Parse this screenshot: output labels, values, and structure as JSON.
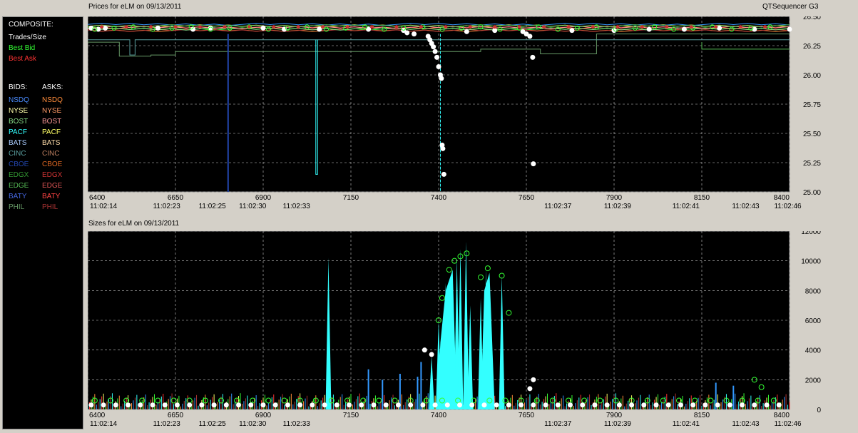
{
  "app_title": "QTSequencer G3",
  "legend": {
    "composite_label": "COMPOSITE:",
    "trades_label": "Trades/Size",
    "best_bid_label": "Best Bid",
    "best_ask_label": "Best Ask",
    "bids_header": "BIDS:",
    "asks_header": "ASKS:",
    "colors": {
      "trades": "#ffffff",
      "best_bid": "#33ff33",
      "best_ask": "#ff3333"
    },
    "exchanges": [
      {
        "bid": "NSDQ",
        "ask": "NSDQ",
        "bid_color": "#4a8cff",
        "ask_color": "#ff8c3a"
      },
      {
        "bid": "NYSE",
        "ask": "NYSE",
        "bid_color": "#ffffaa",
        "ask_color": "#ff9966"
      },
      {
        "bid": "BOST",
        "ask": "BOST",
        "bid_color": "#88dd88",
        "ask_color": "#ff9999"
      },
      {
        "bid": "PACF",
        "ask": "PACF",
        "bid_color": "#33ffff",
        "ask_color": "#ffff66"
      },
      {
        "bid": "BATS",
        "ask": "BATS",
        "bid_color": "#aaccff",
        "ask_color": "#ffddaa"
      },
      {
        "bid": "CINC",
        "ask": "CINC",
        "bid_color": "#5aa0a0",
        "ask_color": "#c08060"
      },
      {
        "bid": "CBOE",
        "ask": "CBOE",
        "bid_color": "#2244aa",
        "ask_color": "#dd6622"
      },
      {
        "bid": "EDGX",
        "ask": "EDGX",
        "bid_color": "#339933",
        "ask_color": "#cc3333"
      },
      {
        "bid": "EDGE",
        "ask": "EDGE",
        "bid_color": "#55bb55",
        "ask_color": "#dd5555"
      },
      {
        "bid": "BATY",
        "ask": "BATY",
        "bid_color": "#4466dd",
        "ask_color": "#ff4444"
      },
      {
        "bid": "PHIL",
        "ask": "PHIL",
        "bid_color": "#669966",
        "ask_color": "#aa3333"
      }
    ]
  },
  "chart_data": [
    {
      "type": "line",
      "title": "Prices for  eLM  on  09/13/2011",
      "ylim": [
        25.0,
        26.5
      ],
      "xlim": [
        6400,
        8400
      ],
      "y_ticks": [
        "25.00",
        "25.25",
        "25.50",
        "25.75",
        "26.00",
        "26.25",
        "26.50"
      ],
      "x_ticks": [
        "6400",
        "6650",
        "6900",
        "7150",
        "7400",
        "7650",
        "7900",
        "8150",
        "8400"
      ],
      "time_labels": [
        "11:02:14",
        "11:02:23",
        "11:02:25",
        "11:02:30",
        "11:02:33",
        "11:02:37",
        "11:02:39",
        "11:02:41",
        "11:02:43",
        "11:02:46"
      ],
      "grid": true,
      "series": [
        {
          "name": "Best Bid",
          "color": "#33ff33",
          "values": [
            [
              6400,
              26.41
            ],
            [
              7400,
              26.4
            ],
            [
              8400,
              26.4
            ]
          ]
        },
        {
          "name": "Best Ask",
          "color": "#ff3333",
          "values": [
            [
              6400,
              26.43
            ],
            [
              7400,
              26.42
            ],
            [
              8400,
              26.42
            ]
          ]
        },
        {
          "name": "Trades/Size",
          "color": "#ffffff",
          "type": "scatter",
          "points": [
            [
              6410,
              26.4
            ],
            [
              6430,
              26.39
            ],
            [
              6450,
              26.4
            ],
            [
              6600,
              26.4
            ],
            [
              6700,
              26.39
            ],
            [
              6750,
              26.4
            ],
            [
              6900,
              26.4
            ],
            [
              6960,
              26.39
            ],
            [
              7060,
              26.39
            ],
            [
              7200,
              26.39
            ],
            [
              7300,
              26.38
            ],
            [
              7310,
              26.36
            ],
            [
              7330,
              26.35
            ],
            [
              7370,
              26.33
            ],
            [
              7375,
              26.3
            ],
            [
              7380,
              26.27
            ],
            [
              7385,
              26.24
            ],
            [
              7390,
              26.2
            ],
            [
              7395,
              26.15
            ],
            [
              7400,
              26.07
            ],
            [
              7405,
              26.0
            ],
            [
              7408,
              25.97
            ],
            [
              7410,
              25.4
            ],
            [
              7412,
              25.37
            ],
            [
              7415,
              25.15
            ],
            [
              7480,
              26.37
            ],
            [
              7560,
              26.38
            ],
            [
              7640,
              26.37
            ],
            [
              7650,
              26.35
            ],
            [
              7660,
              26.33
            ],
            [
              7668,
              26.15
            ],
            [
              7670,
              25.24
            ],
            [
              7780,
              26.38
            ],
            [
              7900,
              26.38
            ],
            [
              8000,
              26.39
            ],
            [
              8100,
              26.39
            ],
            [
              8200,
              26.4
            ],
            [
              8300,
              26.39
            ],
            [
              8400,
              26.39
            ]
          ]
        }
      ]
    },
    {
      "type": "area",
      "title": "Sizes for  eLM  on  09/13/2011",
      "ylim": [
        0,
        12000
      ],
      "xlim": [
        6400,
        8400
      ],
      "y_ticks": [
        "0",
        "2000",
        "4000",
        "6000",
        "8000",
        "10000",
        "12000"
      ],
      "x_ticks": [
        "6400",
        "6650",
        "6900",
        "7150",
        "7400",
        "7650",
        "7900",
        "8150",
        "8400"
      ],
      "time_labels": [
        "11:02:14",
        "11:02:23",
        "11:02:25",
        "11:02:30",
        "11:02:33",
        "11:02:37",
        "11:02:39",
        "11:02:41",
        "11:02:43",
        "11:02:46"
      ],
      "grid": true,
      "series": [
        {
          "name": "PACF",
          "color": "#33ffff",
          "spikes": [
            [
              7086,
              10200
            ],
            [
              7380,
              3600
            ],
            [
              7400,
              6000
            ],
            [
              7420,
              8500
            ],
            [
              7440,
              9000
            ],
            [
              7452,
              10200
            ],
            [
              7462,
              10800
            ],
            [
              7478,
              11300
            ],
            [
              7490,
              7000
            ],
            [
              7520,
              7500
            ],
            [
              7535,
              9400
            ],
            [
              7580,
              9000
            ]
          ]
        },
        {
          "name": "BATS",
          "color": "#3399ff",
          "spikes": [
            [
              7200,
              2700
            ],
            [
              7240,
              2000
            ],
            [
              7290,
              2400
            ],
            [
              7340,
              2200
            ],
            [
              7350,
              3200
            ],
            [
              8190,
              1800
            ],
            [
              8240,
              1600
            ]
          ]
        },
        {
          "name": "Best Bid",
          "color": "#33ff33",
          "type": "scatter",
          "points": [
            [
              7400,
              6000
            ],
            [
              7410,
              7500
            ],
            [
              7430,
              9400
            ],
            [
              7445,
              10000
            ],
            [
              7462,
              10300
            ],
            [
              7480,
              10500
            ],
            [
              7520,
              8900
            ],
            [
              7540,
              9500
            ],
            [
              7580,
              9000
            ],
            [
              7600,
              6500
            ],
            [
              8300,
              2000
            ],
            [
              8320,
              1500
            ]
          ]
        },
        {
          "name": "Trades/Size",
          "color": "#ffffff",
          "type": "scatter",
          "points": [
            [
              7360,
              4000
            ],
            [
              7380,
              3700
            ],
            [
              7670,
              2000
            ],
            [
              7660,
              1400
            ]
          ]
        }
      ]
    }
  ]
}
